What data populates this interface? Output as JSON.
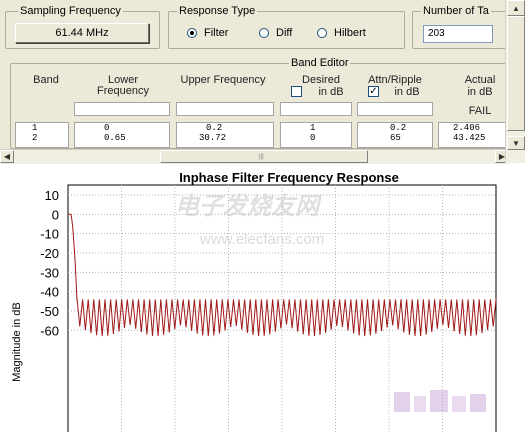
{
  "sampling": {
    "label": "Sampling Frequency",
    "value": "61.44 MHz"
  },
  "response_type": {
    "label": "Response Type",
    "options": [
      {
        "label": "Filter",
        "selected": true
      },
      {
        "label": "Diff",
        "selected": false
      },
      {
        "label": "Hilbert",
        "selected": false
      }
    ]
  },
  "taps": {
    "label": "Number of Ta",
    "value": "203"
  },
  "band_editor": {
    "label": "Band Editor",
    "columns": {
      "band": "Band",
      "lower": "Lower Frequency",
      "upper": "Upper Frequency",
      "desired": "Desired",
      "desired_sub": "in dB",
      "attn": "Attn/Ripple",
      "attn_sub": "in dB",
      "actual": "Actual",
      "actual_sub": "in dB"
    },
    "desired_in_db_checked": false,
    "attn_in_db_checked": true,
    "status": "FAIL",
    "rows": [
      {
        "band": "1",
        "lower": "0",
        "upper": "0.2",
        "desired": "1",
        "attn": "0.2",
        "actual": "2.406"
      },
      {
        "band": "2",
        "lower": "0.65",
        "upper": "30.72",
        "desired": "0",
        "attn": "65",
        "actual": "43.425"
      }
    ]
  },
  "watermark": {
    "logo_text": "电子发烧友网",
    "url": "www.elecfans.com"
  },
  "colors": {
    "panel": "#ece9d8",
    "trace": "#a01818",
    "grid": "#b4b4b4"
  },
  "chart_data": {
    "type": "line",
    "title": "Inphase Filter Frequency Response",
    "ylabel": "Magnitude in dB",
    "xlabel": "",
    "yticks": [
      10,
      0,
      -10,
      -20,
      -30,
      -40,
      -50,
      -60
    ],
    "ylim": [
      -65,
      10
    ],
    "xlim": [
      0,
      30.72
    ],
    "x_unit": "MHz",
    "grid": true,
    "series": [
      {
        "passband": {
          "x_end": 0.2,
          "db": 0
        },
        "transition": {
          "x_start": 0.2,
          "x_end": 0.65,
          "db_end": -45
        },
        "stopband": {
          "x_start": 0.65,
          "x_end": 30.72,
          "peak_db": -44,
          "trough_db": -63,
          "lobe_count": 75,
          "envelope_arches": 8
        }
      }
    ]
  }
}
